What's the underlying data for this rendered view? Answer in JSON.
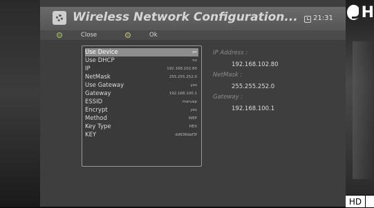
{
  "header": {
    "title": "Wireless Network Configuration...",
    "time": "21:31"
  },
  "toolbar": {
    "close_label": "Close",
    "ok_label": "Ok"
  },
  "settings": [
    {
      "label": "Use Device",
      "value": "on",
      "selected": true
    },
    {
      "label": "Use DHCP",
      "value": "no"
    },
    {
      "label": "IP",
      "value": "192.168.102.80"
    },
    {
      "label": "NetMask",
      "value": "255.255.252.0"
    },
    {
      "label": "Use Gateway",
      "value": "yes"
    },
    {
      "label": "Gateway",
      "value": "192.168.100.1"
    },
    {
      "label": "ESSID",
      "value": "maruap"
    },
    {
      "label": "Encrypt",
      "value": "yes"
    },
    {
      "label": "Method",
      "value": "WEP"
    },
    {
      "label": "Key Type",
      "value": "HEX"
    },
    {
      "label": "KEY",
      "value": "dd636daf3f"
    }
  ],
  "status": {
    "ip_label": "IP Address :",
    "ip_value": "192.168.102.80",
    "netmask_label": "NetMask :",
    "netmask_value": "255.255.252.0",
    "gateway_label": "Gateway :",
    "gateway_value": "192.168.100.1"
  },
  "overlay": {
    "logo_text": "H",
    "hd_badge": "HD"
  },
  "icons": {
    "header": "settings-icon",
    "clock": "clock-icon",
    "close": "green-dot-icon",
    "ok": "yellow-dot-icon"
  },
  "colors": {
    "panel": "#3e3e3e",
    "header": "#5e5e5e",
    "selected_row": "#8e8e8e",
    "status_label": "#8c8c8c"
  }
}
